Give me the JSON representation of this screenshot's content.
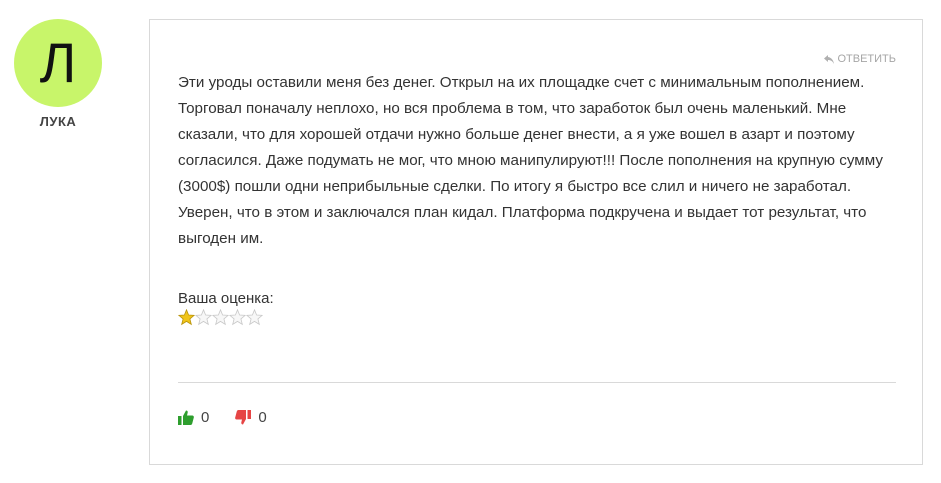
{
  "author": {
    "initial": "Л",
    "name": "ЛУКА"
  },
  "review": {
    "reply_label": "ОТВЕТИТЬ",
    "text": "Эти уроды оставили меня без денег. Открыл на их площадке счет с минимальным пополнением. Торговал поначалу неплохо, но вся проблема в том, что заработок был очень маленький. Мне сказали, что для хорошей отдачи нужно больше денег внести, а я уже вошел в азарт и поэтому согласился. Даже подумать не мог, что мною манипулируют!!! После пополнения на крупную сумму (3000$) пошли одни неприбыльные сделки. По итогу я быстро все слил и ничего не заработал. Уверен, что в этом и заключался план кидал. Платформа подкручена и выдает тот результат, что выгоден им.",
    "rating_label": "Ваша оценка:",
    "rating": 1,
    "rating_max": 5,
    "likes": "0",
    "dislikes": "0"
  },
  "colors": {
    "avatar_bg": "#c8f56a",
    "like_green": "#2e9e2e",
    "dislike_red": "#e64545",
    "star_gold": "#f0c419",
    "star_empty": "#e3e3e3"
  },
  "icons": {
    "reply": "reply-arrow-icon",
    "like": "thumbs-up-icon",
    "dislike": "thumbs-down-icon",
    "star": "star-icon"
  }
}
